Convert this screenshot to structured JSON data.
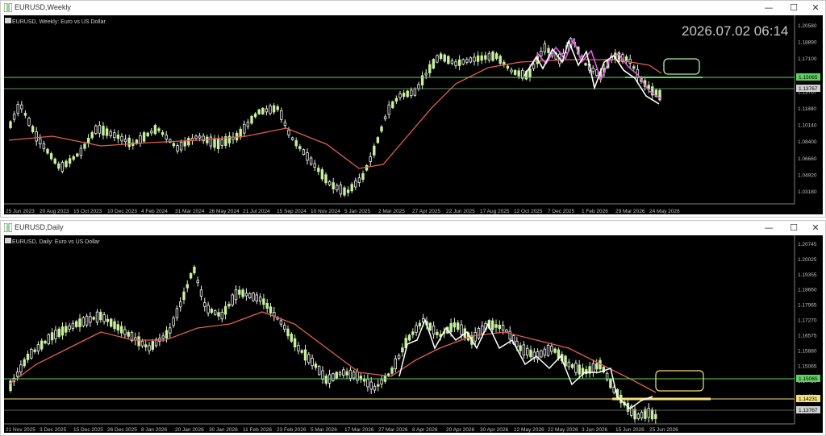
{
  "top_window": {
    "title": "EURUSD,Weekly",
    "symbol_line": "EURUSD, Weekly: Euro vs US Dollar",
    "clock": "2026.07.02 06:14",
    "controls": {
      "minimize": "—",
      "maximize": "☐",
      "close": "✕"
    },
    "price_axis": [
      "1.20580",
      "1.18890",
      "1.17100",
      "1.15065",
      "1.13767",
      "1.11880",
      "1.10140",
      "1.08400",
      "1.06660",
      "1.04920",
      "1.03180"
    ],
    "time_axis": [
      "25 Jun 2023",
      "20 Aug 2023",
      "15 Oct 2023",
      "10 Dec 2023",
      "4 Feb 2024",
      "31 Mar 2024",
      "26 May 2024",
      "21 Jul 2024",
      "15 Sep 2024",
      "10 Nov 2024",
      "5 Jan 2025",
      "2 Mar 2025",
      "27 Apr 2025",
      "22 Jun 2025",
      "17 Aug 2025",
      "12 Oct 2025",
      "7 Dec 2025",
      "1 Feb 2026",
      "29 Mar 2026",
      "24 May 2026"
    ]
  },
  "bottom_window": {
    "title": "EURUSD,Daily",
    "symbol_line": "EURUSD, Daily: Euro vs US Dollar",
    "controls": {
      "minimize": "—",
      "maximize": "☐",
      "close": "✕"
    },
    "price_axis": [
      "1.20745",
      "1.20025",
      "1.19355",
      "1.18660",
      "1.17965",
      "1.17270",
      "1.16575",
      "1.15880",
      "1.15065",
      "1.14490",
      "1.14231",
      "1.13767"
    ],
    "time_axis": [
      "21 Nov 2025",
      "3 Dec 2025",
      "15 Dec 2025",
      "26 Dec 2025",
      "8 Jan 2026",
      "20 Jan 2026",
      "30 Jan 2026",
      "11 Feb 2026",
      "23 Feb 2026",
      "5 Mar 2026",
      "17 Mar 2026",
      "27 Mar 2026",
      "8 Apr 2026",
      "20 Apr 2026",
      "30 Apr 2026",
      "12 May 2026",
      "22 May 2026",
      "3 Jun 2026",
      "15 Jun 2026",
      "25 Jun 2026"
    ]
  },
  "colors": {
    "background": "#000000",
    "bull_candle": "#c8f0a0",
    "bear_candle": "#f2f2f2",
    "moving_average": "#e0604e",
    "green_level": "#5fd35f",
    "yellow_level": "#f5e17a",
    "zigzag_white": "#ffffff",
    "zigzag_magenta": "#e05ce0",
    "axis_text": "#c0c0c0",
    "gridless": true
  }
}
